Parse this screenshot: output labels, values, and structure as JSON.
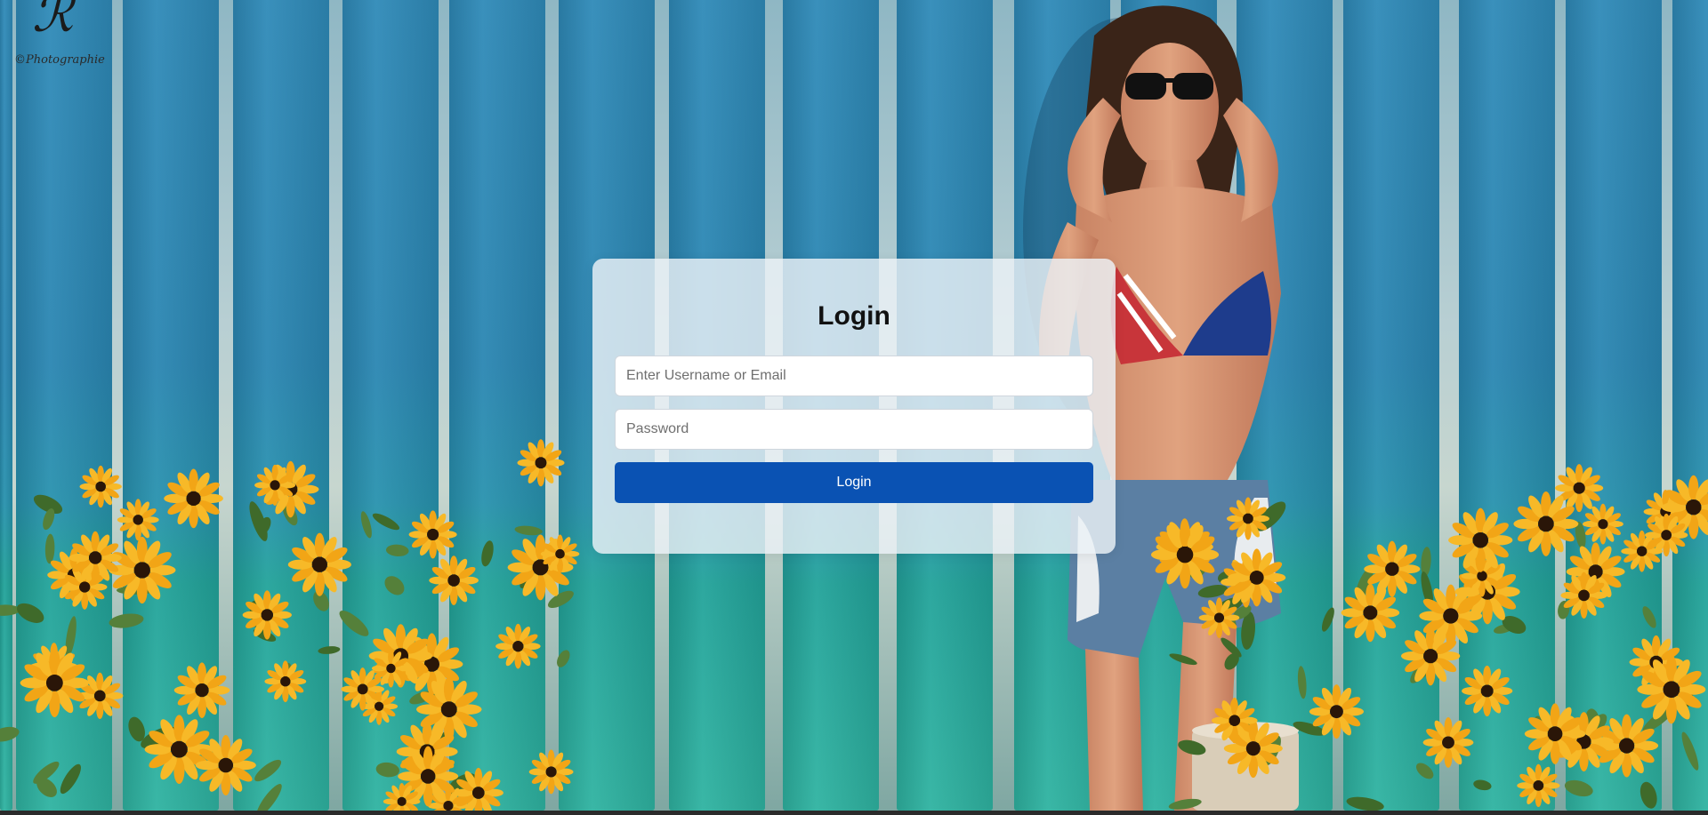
{
  "background": {
    "watermark_text": "©Photographie"
  },
  "login": {
    "title": "Login",
    "username_placeholder": "Enter Username or Email",
    "password_placeholder": "Password",
    "submit_label": "Login"
  },
  "colors": {
    "button": "#0a52b3",
    "card": "#ecf2f7",
    "fence": "#2a86b2"
  }
}
